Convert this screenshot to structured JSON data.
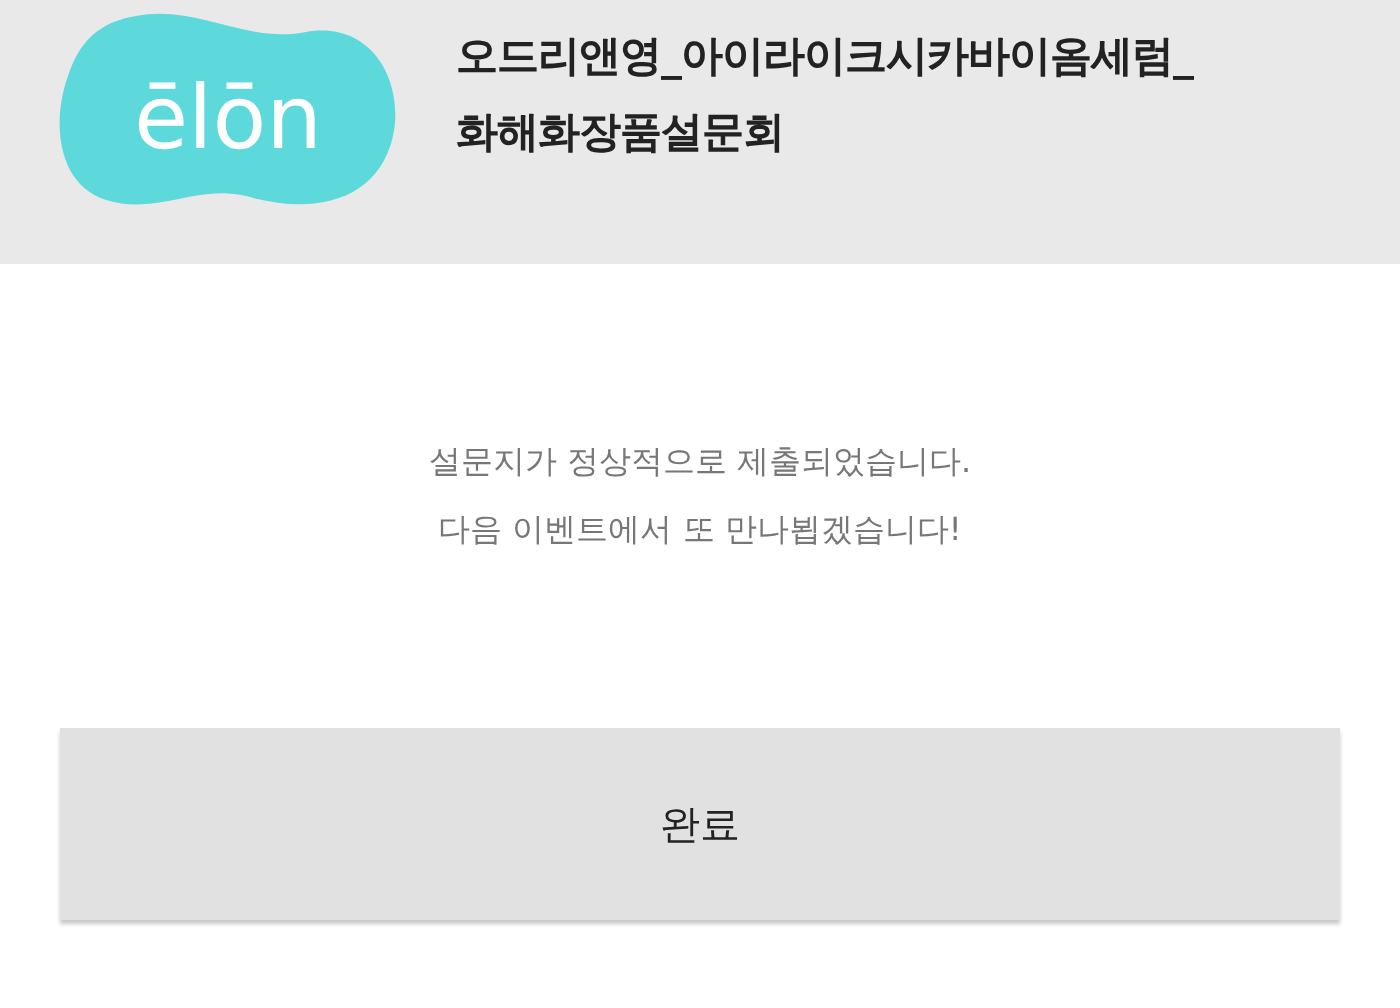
{
  "header": {
    "logo": "ēlōn",
    "title_lines": [
      "오드리앤영_아이라이크시카바이옴세럼_",
      "화해화장품설문회"
    ]
  },
  "message": {
    "lines": [
      "설문지가 정상적으로 제출되었습니다.",
      "다음 이벤트에서 또 만나뵙겠습니다!"
    ]
  },
  "buttons": [
    {
      "label": "완료"
    }
  ]
}
